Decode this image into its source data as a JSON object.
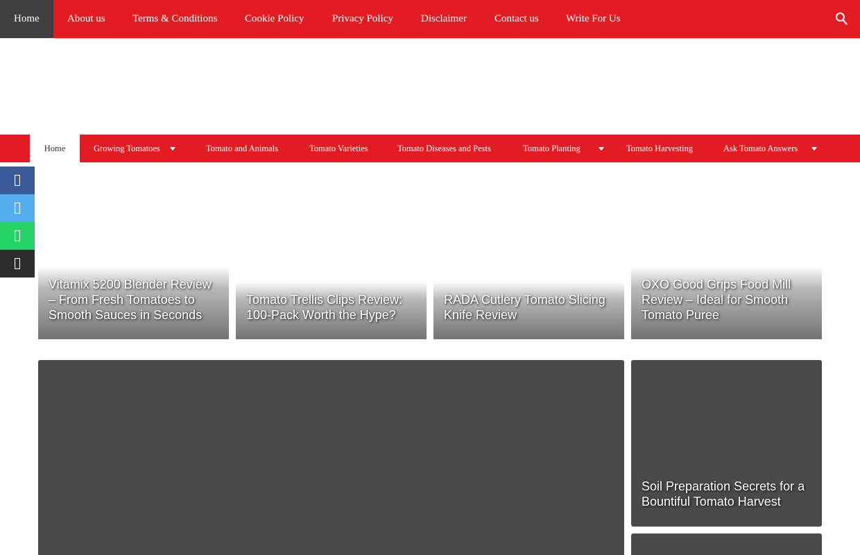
{
  "top_nav": {
    "items": [
      "Home",
      "About us",
      "Terms & Conditions",
      "Cookie Policy",
      "Privacy Policy",
      "Disclaimer",
      "Contact us",
      "Write For Us"
    ],
    "search_icon": "search-icon"
  },
  "sub_nav": {
    "items": [
      "Home",
      "Growing Tomatoes",
      "Tomato and Animals",
      "Tomato Varieties",
      "Tomato Diseases and Pests",
      "Tomato Planting",
      "Tomato Harvesting",
      "Ask Tomato Answers"
    ],
    "dropdowns": [
      "Growing Tomatoes",
      "Tomato Planting",
      "Ask Tomato Answers"
    ]
  },
  "share": {
    "buttons": [
      {
        "icon": "facebook-icon",
        "color": "#3b5998"
      },
      {
        "icon": "twitter-icon",
        "color": "#55acee"
      },
      {
        "icon": "whatsapp-icon",
        "color": "#25d366"
      },
      {
        "icon": "share-icon",
        "color": "#2c2c2c"
      }
    ]
  },
  "posts": [
    {
      "title": "Vitamix 5200 Blender Review – From Fresh Tomatoes to Smooth Sauces in Seconds"
    },
    {
      "title": "Tomato Trellis Clips Review: 100-Pack Worth the Hype?"
    },
    {
      "title": "RADA Cutlery Tomato Slicing Knife Review"
    },
    {
      "title": "OXO Good Grips Food Mill Review – Ideal for Smooth Tomato Puree"
    },
    {
      "title": ""
    },
    {
      "title": "Soil Preparation Secrets for a Bountiful Tomato Harvest"
    },
    {
      "title": ""
    }
  ],
  "colors": {
    "brand_red": "#e31b23",
    "active_dark": "#3f3f3f",
    "card_dark": "#4a4a4a"
  }
}
